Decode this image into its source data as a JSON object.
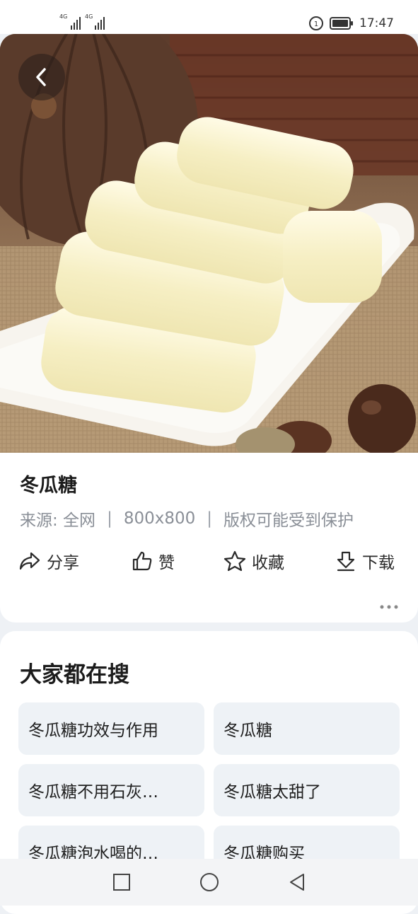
{
  "status_bar": {
    "signal1_label": "4G",
    "signal2_label": "4G",
    "time": "17:47"
  },
  "detail": {
    "title": "冬瓜糖",
    "source": "来源: 全网",
    "dimensions": "800x800",
    "copyright": "版权可能受到保护",
    "separator": "|"
  },
  "actions": {
    "share": "分享",
    "like": "赞",
    "favorite": "收藏",
    "download": "下载"
  },
  "search": {
    "title": "大家都在搜",
    "items": [
      "冬瓜糖功效与作用",
      "冬瓜糖",
      "冬瓜糖不用石灰…",
      "冬瓜糖太甜了",
      "冬瓜糖泡水喝的…",
      "冬瓜糖购买"
    ]
  },
  "colors": {
    "background": "#eef1f5",
    "card": "#ffffff",
    "chip": "#eef2f6",
    "meta_text": "#8a8f97"
  }
}
